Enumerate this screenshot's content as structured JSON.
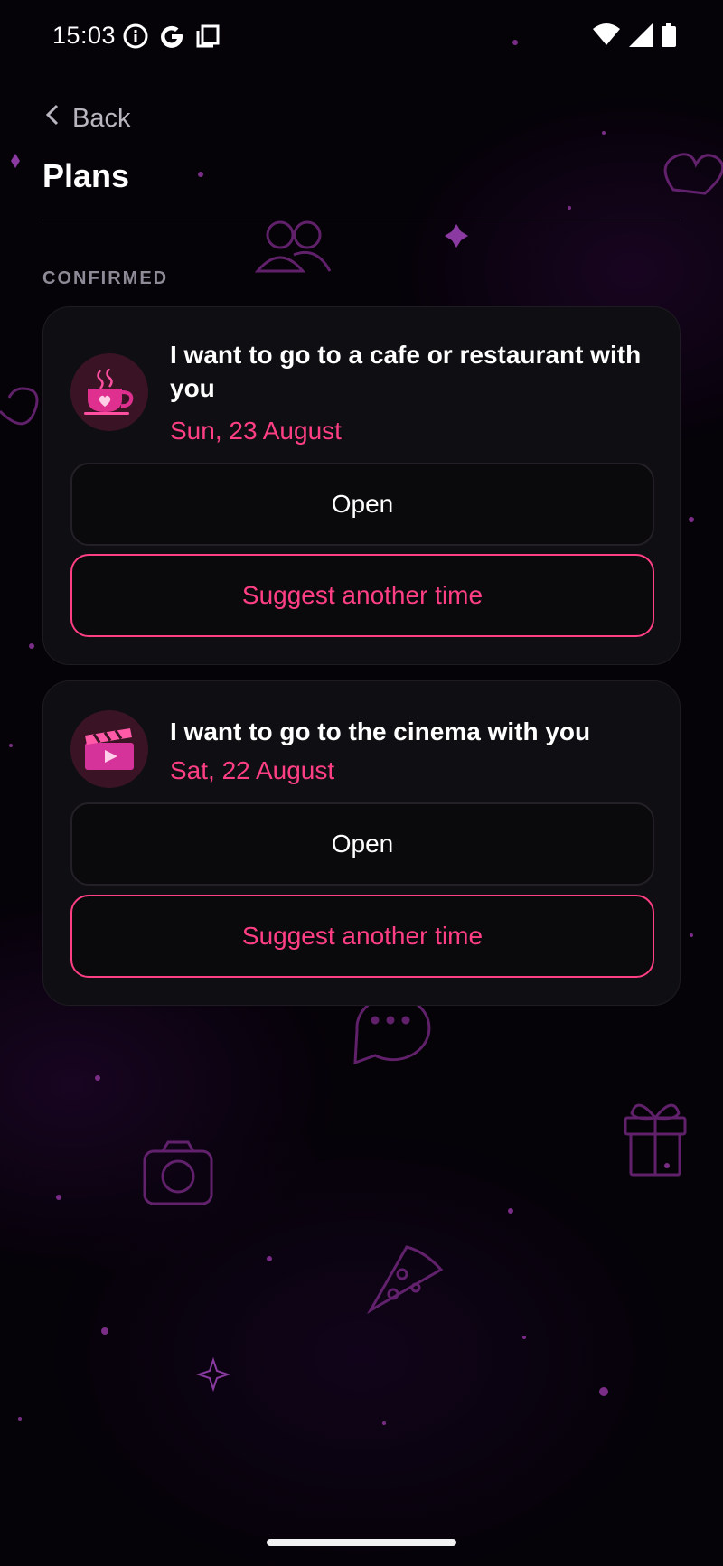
{
  "status_bar": {
    "time": "15:03",
    "left_icons": [
      "info-icon",
      "google-icon",
      "copy-icon"
    ],
    "right_icons": [
      "wifi-icon",
      "signal-icon",
      "battery-icon"
    ]
  },
  "header": {
    "back_label": "Back",
    "title": "Plans"
  },
  "section": {
    "label": "CONFIRMED"
  },
  "plans": [
    {
      "icon": "coffee-cup-heart-icon",
      "title": "I want to go to a cafe or restaurant with you",
      "date": "Sun, 23 August",
      "open_label": "Open",
      "suggest_label": "Suggest another time"
    },
    {
      "icon": "clapperboard-icon",
      "title": "I want to go to the cinema with you",
      "date": "Sat, 22 August",
      "open_label": "Open",
      "suggest_label": "Suggest another time"
    }
  ],
  "colors": {
    "accent": "#ff3f84",
    "background": "#050208",
    "card": "#0f0e12",
    "decor": "#7a2d86"
  }
}
